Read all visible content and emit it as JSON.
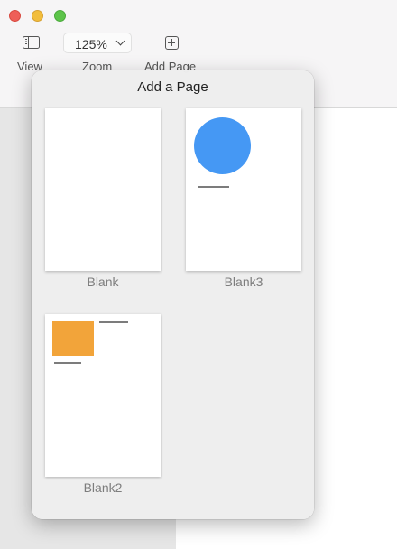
{
  "toolbar": {
    "view_label": "View",
    "zoom_label": "Zoom",
    "zoom_value": "125%",
    "add_page_label": "Add Page"
  },
  "popover": {
    "title": "Add a Page",
    "templates": [
      {
        "label": "Blank"
      },
      {
        "label": "Blank3"
      },
      {
        "label": "Blank2"
      }
    ]
  },
  "colors": {
    "circle": "#4598f4",
    "orange_rect": "#f2a43a"
  }
}
